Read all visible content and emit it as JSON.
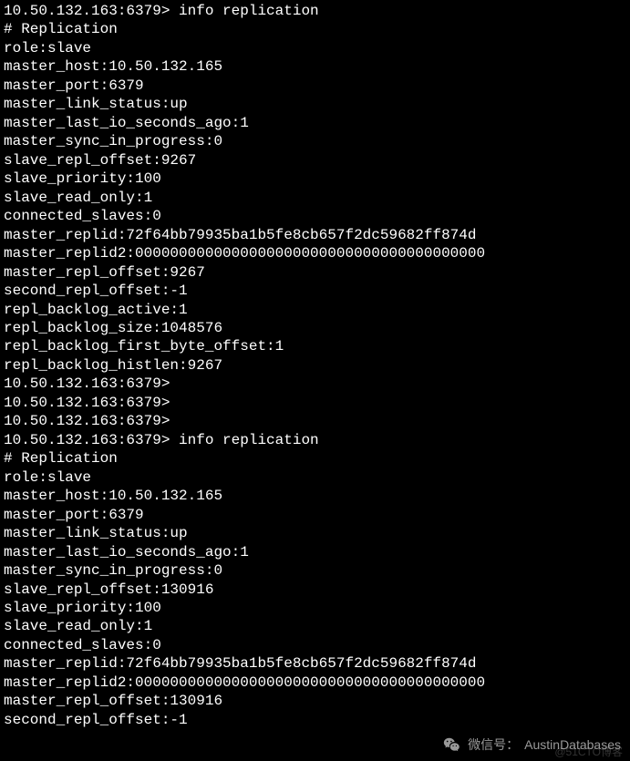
{
  "lines": [
    "10.50.132.163:6379> info replication",
    "# Replication",
    "role:slave",
    "master_host:10.50.132.165",
    "master_port:6379",
    "master_link_status:up",
    "master_last_io_seconds_ago:1",
    "master_sync_in_progress:0",
    "slave_repl_offset:9267",
    "slave_priority:100",
    "slave_read_only:1",
    "connected_slaves:0",
    "master_replid:72f64bb79935ba1b5fe8cb657f2dc59682ff874d",
    "master_replid2:0000000000000000000000000000000000000000",
    "master_repl_offset:9267",
    "second_repl_offset:-1",
    "repl_backlog_active:1",
    "repl_backlog_size:1048576",
    "repl_backlog_first_byte_offset:1",
    "repl_backlog_histlen:9267",
    "10.50.132.163:6379>",
    "10.50.132.163:6379>",
    "10.50.132.163:6379>",
    "10.50.132.163:6379> info replication",
    "# Replication",
    "role:slave",
    "master_host:10.50.132.165",
    "master_port:6379",
    "master_link_status:up",
    "master_last_io_seconds_ago:1",
    "master_sync_in_progress:0",
    "slave_repl_offset:130916",
    "slave_priority:100",
    "slave_read_only:1",
    "connected_slaves:0",
    "master_replid:72f64bb79935ba1b5fe8cb657f2dc59682ff874d",
    "master_replid2:0000000000000000000000000000000000000000",
    "master_repl_offset:130916",
    "second_repl_offset:-1"
  ],
  "watermark": {
    "label": "微信号：",
    "value": "AustinDatabases"
  },
  "blog_watermark": "@51CTO博客"
}
